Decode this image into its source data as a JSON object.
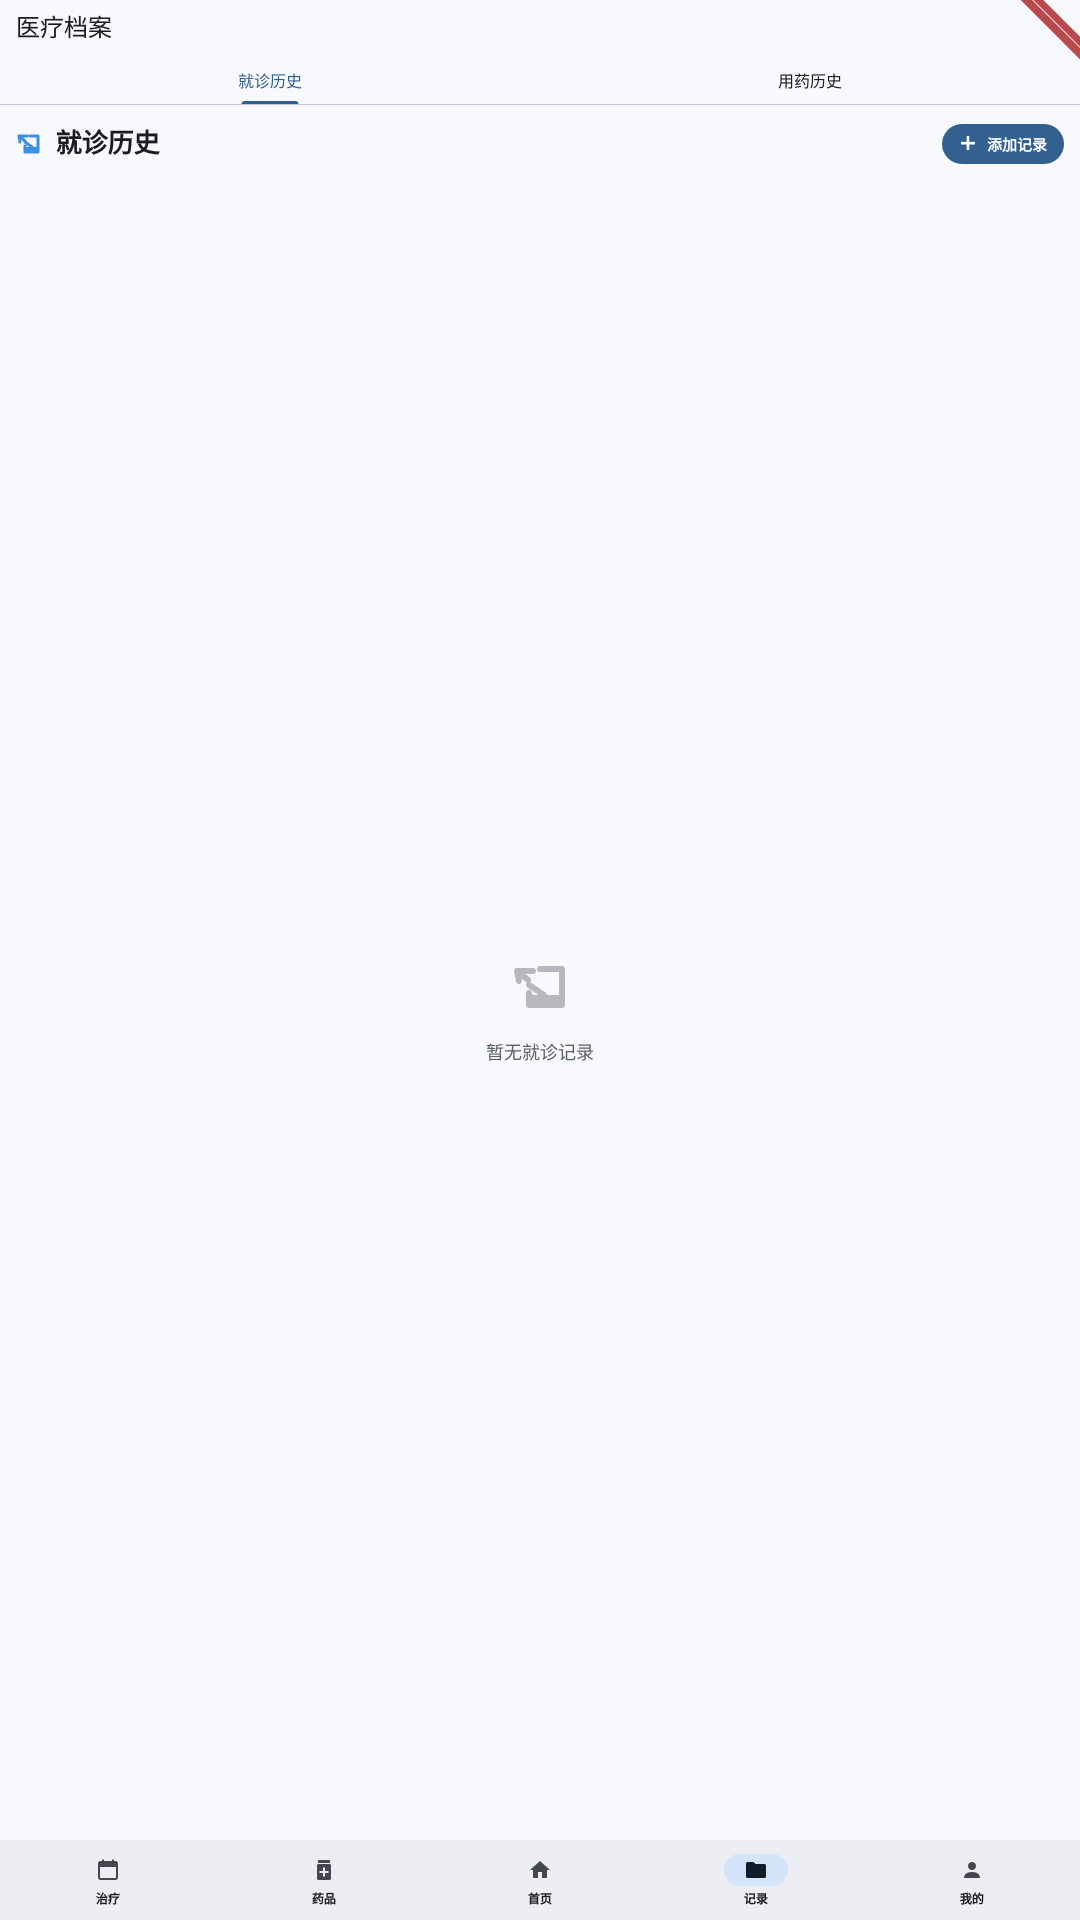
{
  "appbar": {
    "title": "医疗档案"
  },
  "tabs": [
    {
      "label": "就诊历史",
      "active": true
    },
    {
      "label": "用药历史",
      "active": false
    }
  ],
  "section": {
    "title": "就诊历史",
    "icon": "visit-record-icon",
    "add_button_label": "添加记录",
    "add_button_icon": "plus-icon"
  },
  "empty_state": {
    "icon": "visit-record-icon",
    "text": "暂无就诊记录"
  },
  "bottom_nav": {
    "items": [
      {
        "label": "治疗",
        "icon": "calendar-icon",
        "active": false
      },
      {
        "label": "药品",
        "icon": "medication-icon",
        "active": false
      },
      {
        "label": "首页",
        "icon": "home-icon",
        "active": false
      },
      {
        "label": "记录",
        "icon": "folder-icon",
        "active": true
      },
      {
        "label": "我的",
        "icon": "person-icon",
        "active": false
      }
    ]
  },
  "colors": {
    "primary": "#33618f",
    "background": "#f8f9ff",
    "nav_background": "#eceef4",
    "nav_active_pill": "#d3e4fb",
    "section_icon": "#3d8fe0",
    "empty_icon": "#b7b8bb"
  }
}
